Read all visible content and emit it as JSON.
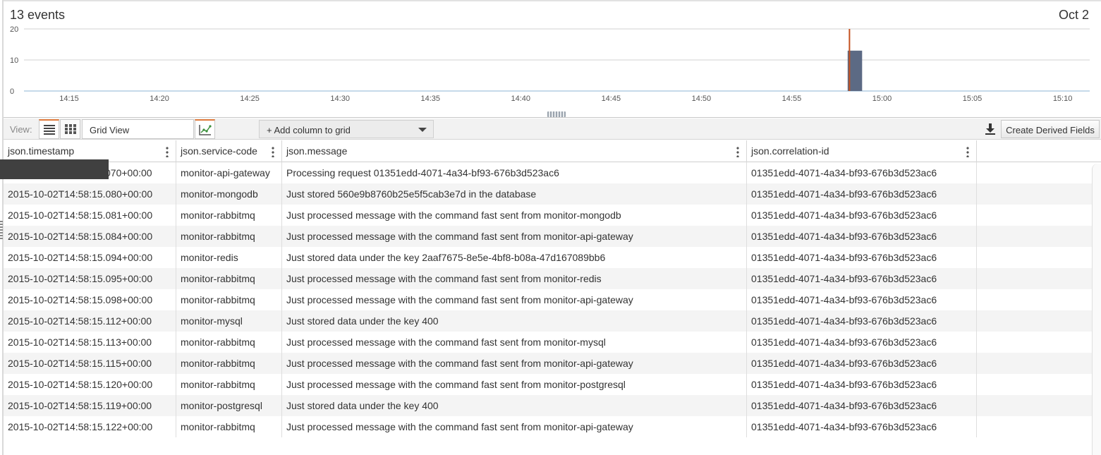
{
  "header": {
    "events_count": "13 events",
    "date_label": "Oct 2"
  },
  "chart_data": {
    "type": "bar",
    "yticks": [
      "20",
      "10",
      "0"
    ],
    "ylim": [
      0,
      20
    ],
    "xticks": [
      "14:15",
      "14:20",
      "14:25",
      "14:30",
      "14:35",
      "14:40",
      "14:45",
      "14:50",
      "14:55",
      "15:00",
      "15:05",
      "15:10"
    ],
    "x_start_minutes": 12.5,
    "x_end_minutes": 71.5,
    "bars": [
      {
        "start_minutes": 58.1,
        "end_minutes": 58.9,
        "value": 13
      }
    ],
    "marker_minutes": 58.2,
    "colors": {
      "bar": "#5c6a84",
      "marker": "#c4501e",
      "grid": "#d0d0d0",
      "axis": "#8eb4d6"
    }
  },
  "toolbar": {
    "view_label": "View:",
    "view_name": "Grid View",
    "add_column_label": "+ Add column to grid",
    "create_derived_label": "Create Derived Fields"
  },
  "grid": {
    "columns": [
      {
        "label": "json.timestamp"
      },
      {
        "label": "json.service-code"
      },
      {
        "label": "json.message"
      },
      {
        "label": "json.correlation-id"
      }
    ],
    "rows": [
      [
        "070+00:00",
        "monitor-api-gateway",
        "Processing request 01351edd-4071-4a34-bf93-676b3d523ac6",
        "01351edd-4071-4a34-bf93-676b3d523ac6"
      ],
      [
        "2015-10-02T14:58:15.080+00:00",
        "monitor-mongodb",
        "Just stored 560e9b8760b25e5f5cab3e7d in the database",
        "01351edd-4071-4a34-bf93-676b3d523ac6"
      ],
      [
        "2015-10-02T14:58:15.081+00:00",
        "monitor-rabbitmq",
        "Just processed message with the command fast sent from monitor-mongodb",
        "01351edd-4071-4a34-bf93-676b3d523ac6"
      ],
      [
        "2015-10-02T14:58:15.084+00:00",
        "monitor-rabbitmq",
        "Just processed message with the command fast sent from monitor-api-gateway",
        "01351edd-4071-4a34-bf93-676b3d523ac6"
      ],
      [
        "2015-10-02T14:58:15.094+00:00",
        "monitor-redis",
        "Just stored data under the key 2aaf7675-8e5e-4bf8-b08a-47d167089bb6",
        "01351edd-4071-4a34-bf93-676b3d523ac6"
      ],
      [
        "2015-10-02T14:58:15.095+00:00",
        "monitor-rabbitmq",
        "Just processed message with the command fast sent from monitor-redis",
        "01351edd-4071-4a34-bf93-676b3d523ac6"
      ],
      [
        "2015-10-02T14:58:15.098+00:00",
        "monitor-rabbitmq",
        "Just processed message with the command fast sent from monitor-api-gateway",
        "01351edd-4071-4a34-bf93-676b3d523ac6"
      ],
      [
        "2015-10-02T14:58:15.112+00:00",
        "monitor-mysql",
        "Just stored data under the key 400",
        "01351edd-4071-4a34-bf93-676b3d523ac6"
      ],
      [
        "2015-10-02T14:58:15.113+00:00",
        "monitor-rabbitmq",
        "Just processed message with the command fast sent from monitor-mysql",
        "01351edd-4071-4a34-bf93-676b3d523ac6"
      ],
      [
        "2015-10-02T14:58:15.115+00:00",
        "monitor-rabbitmq",
        "Just processed message with the command fast sent from monitor-api-gateway",
        "01351edd-4071-4a34-bf93-676b3d523ac6"
      ],
      [
        "2015-10-02T14:58:15.120+00:00",
        "monitor-rabbitmq",
        "Just processed message with the command fast sent from monitor-postgresql",
        "01351edd-4071-4a34-bf93-676b3d523ac6"
      ],
      [
        "2015-10-02T14:58:15.119+00:00",
        "monitor-postgresql",
        "Just stored data under the key 400",
        "01351edd-4071-4a34-bf93-676b3d523ac6"
      ],
      [
        "2015-10-02T14:58:15.122+00:00",
        "monitor-rabbitmq",
        "Just processed message with the command fast sent from monitor-api-gateway",
        "01351edd-4071-4a34-bf93-676b3d523ac6"
      ]
    ]
  }
}
